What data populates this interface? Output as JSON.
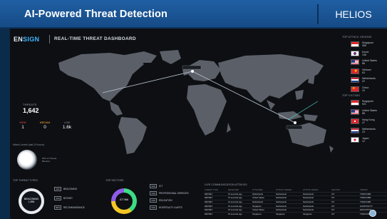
{
  "slide": {
    "title": "AI-Powered Threat Detection",
    "brand": "HELIOS"
  },
  "dashboard": {
    "logo_prefix": "EN",
    "logo_accent": "SIGN",
    "title": "REAL-TIME THREAT DASHBOARD",
    "threats_label": "THREATS",
    "threats_value": "1,642",
    "mini": [
      {
        "label": "HIGH",
        "value": "1"
      },
      {
        "label": "MEDIUM",
        "value": "0"
      },
      {
        "label": "LOW",
        "value": "1.6k"
      }
    ],
    "attack_panel_title": "Attack Levels (last 24 hours)",
    "attack_dial_label": "66% of Threats Blocked",
    "top_attack_origins_title": "TOP ATTACK ORIGINS",
    "top_attack_origins": [
      {
        "country": "Singapore",
        "count": "966",
        "flag": "sg"
      },
      {
        "country": "Korea",
        "count": "136",
        "flag": "kr"
      },
      {
        "country": "United States",
        "count": "88",
        "flag": "us"
      },
      {
        "country": "Vietnam",
        "count": "63",
        "flag": "vn"
      },
      {
        "country": "Netherlands",
        "count": "22",
        "flag": "nl"
      },
      {
        "country": "China",
        "count": "10",
        "flag": "cn"
      }
    ],
    "top_victims_title": "TOP VICTIMS",
    "top_victims": [
      {
        "country": "Singapore",
        "count": "921",
        "flag": "sg"
      },
      {
        "country": "United States",
        "count": "88",
        "flag": "us"
      },
      {
        "country": "Hong Kong",
        "count": "47",
        "flag": "hk"
      },
      {
        "country": "Netherlands",
        "count": "23",
        "flag": "nl"
      },
      {
        "country": "Japan",
        "count": "12",
        "flag": "jp"
      }
    ],
    "top_threat_types_title": "TOP THREAT TYPES",
    "threat_ring_label": "BEACONING 1,596",
    "threat_types": [
      {
        "tag": "C2H",
        "label": "BEACONING"
      },
      {
        "tag": "C2H",
        "label": "BOTNET"
      },
      {
        "tag": "MLN",
        "label": "RECONNAISSANCE"
      }
    ],
    "top_sectors_title": "TOP SECTORS",
    "sector_ring_label": "ICT 966",
    "sectors": [
      {
        "tag": "C2H",
        "label": "ICT"
      },
      {
        "tag": "C2H",
        "label": "PROFESSIONAL SERVICES"
      },
      {
        "tag": "C2H",
        "label": "EDUCATION"
      },
      {
        "tag": "C2H",
        "label": "HOSPITALITY & ARTS"
      }
    ],
    "live_table": {
      "title": "LIVE COMMUNICATION ATTACKS",
      "columns": [
        "THREAT TYPE",
        "DETECTED",
        "ATTACKER",
        "ATTACK TARGET",
        "ATTACK ORIGIN",
        "SECTOR",
        "TARGET"
      ],
      "rows": [
        [
          "DETRET",
          "15 seconds ago",
          "Netherlands",
          "Netherlands",
          "Netherlands",
          "ICT",
          "TRINCOMM"
        ],
        [
          "DETRET",
          "15 seconds ago",
          "United States",
          "Netherlands",
          "Netherlands",
          "ICT",
          "TRINCOMM"
        ],
        [
          "DETRET",
          "15 seconds ago",
          "Netherlands",
          "Netherlands",
          "Netherlands",
          "ICT",
          "TRINCOMM"
        ],
        [
          "DETRET",
          "15 seconds ago",
          "Singapore",
          "Netherlands",
          "Netherlands",
          "ICT",
          "HOSPITALITY"
        ],
        [
          "DETRET",
          "15 seconds ago",
          "United States",
          "Netherlands",
          "Netherlands",
          "ICT",
          "EDUCATION"
        ],
        [
          "DETRET",
          "15 seconds ago",
          "Singapore",
          "Singapore",
          "Singapore",
          "ICT",
          "TRINCOMM"
        ]
      ]
    }
  },
  "colors": {
    "header": "#1f5fa3",
    "background": "#0b2b4a",
    "dashboard": "#0d0f13",
    "ring_green": "#3ddc84",
    "ring_yellow": "#f3c623",
    "ring_purple": "#8e5be8",
    "attack_line": "#b9c3d0"
  }
}
